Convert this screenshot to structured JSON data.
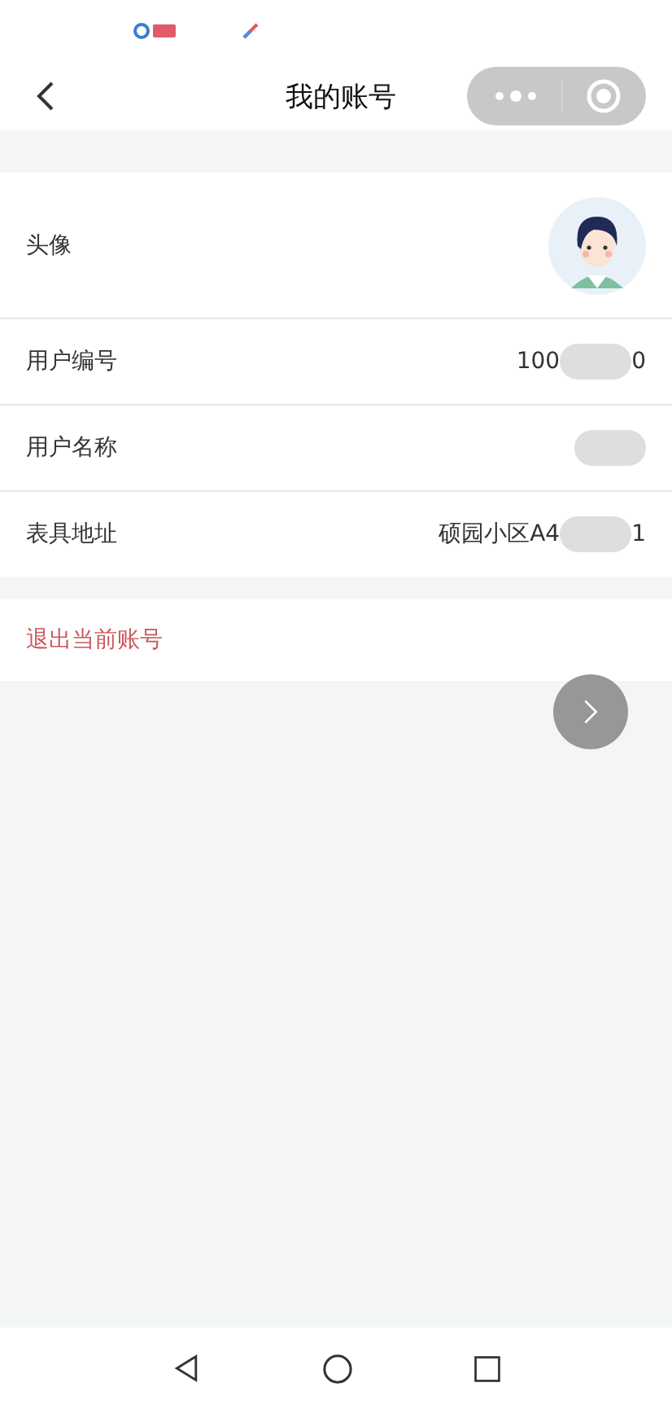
{
  "nav_bar": {
    "title": "我的账号"
  },
  "profile_rows": [
    {
      "kind": "avatar",
      "label": "头像"
    },
    {
      "kind": "text",
      "label": "用户编号",
      "value_start": "100",
      "redacted": true,
      "value_end": "0"
    },
    {
      "kind": "text",
      "label": "用户名称",
      "redacted": true
    },
    {
      "kind": "text",
      "label": "表具地址",
      "value_start": "硕园小区A4",
      "redacted": true,
      "value_end": "1"
    }
  ],
  "logout": {
    "label": "退出当前账号"
  }
}
